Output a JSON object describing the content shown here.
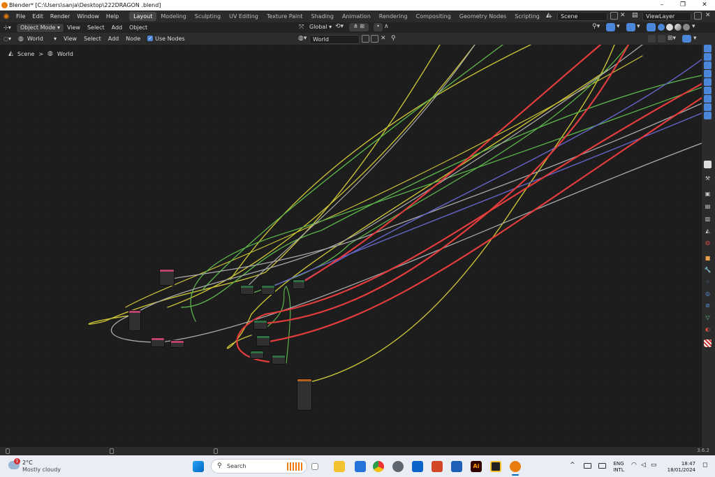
{
  "window": {
    "title": "Blender* [C:\\Users\\sanja\\Desktop\\222DRAGON .blend]",
    "minimize": "–",
    "maximize": "❐",
    "close": "✕"
  },
  "menu": [
    "File",
    "Edit",
    "Render",
    "Window",
    "Help"
  ],
  "workspaces": [
    "Layout",
    "Modeling",
    "Sculpting",
    "UV Editing",
    "Texture Paint",
    "Shading",
    "Animation",
    "Rendering",
    "Compositing",
    "Geometry Nodes",
    "Scripting"
  ],
  "workspace_add": "+",
  "scene": {
    "label": "Scene",
    "view_layer": "ViewLayer"
  },
  "header": {
    "mode": "Object Mode",
    "items": [
      "View",
      "Select",
      "Add",
      "Object"
    ],
    "transform": "Global"
  },
  "node_header": {
    "world_type": "World",
    "items": [
      "View",
      "Select",
      "Add",
      "Node"
    ],
    "use_nodes": "Use Nodes",
    "world_field": "World"
  },
  "breadcrumb": {
    "scene": "Scene",
    "separator": ">",
    "world": "World"
  },
  "version": "3.6.2",
  "colors": {
    "link_yellow": "#c8c037",
    "link_green": "#5bb24a",
    "link_gray": "#a8a8a8",
    "link_red": "#e23c3c",
    "link_purple": "#6565c9",
    "accent": "#4b86d8"
  },
  "taskbar": {
    "weather_temp": "2°C",
    "weather_desc": "Mostly cloudy",
    "weather_badge": "1",
    "search": "Search",
    "lang": "ENG",
    "lang_sub": "INTL",
    "time": "18:47",
    "date": "18/01/2024",
    "app_ai": "Ai",
    "overflow_arrow": "^"
  }
}
